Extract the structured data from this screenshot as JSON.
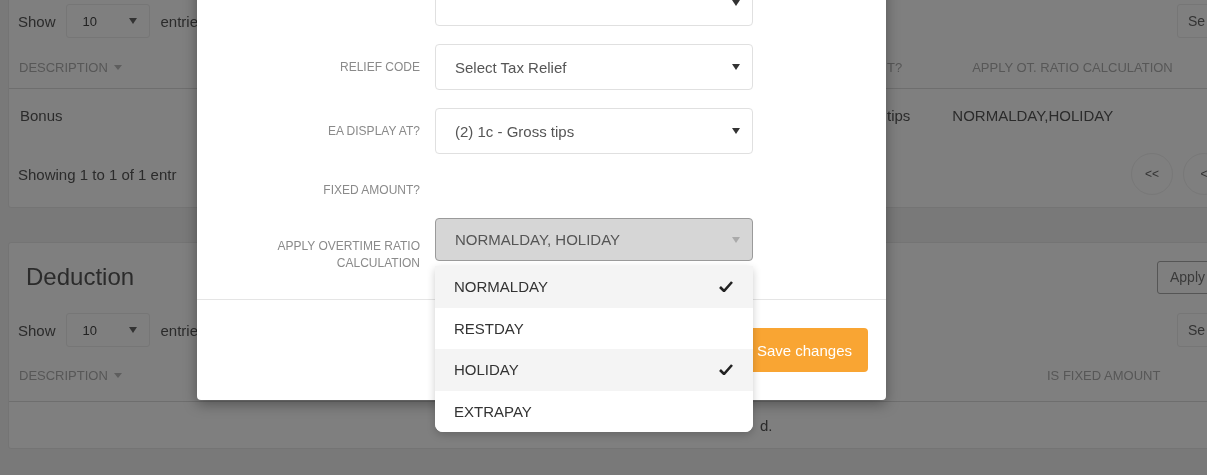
{
  "earnings": {
    "length": {
      "label": "Show",
      "value": "10",
      "suffix": "entrie"
    },
    "search": {
      "placeholder": "Se"
    },
    "columns": [
      {
        "label": "DESCRIPTION",
        "sortable": true
      },
      {
        "label": "T?",
        "sortable": false
      },
      {
        "label": "APPLY OT. RATIO CALCULATION",
        "sortable": false
      }
    ],
    "rows": [
      {
        "cells": [
          "Bonus",
          "tips",
          "NORMALDAY,HOLIDAY"
        ]
      }
    ],
    "info": "Showing 1 to 1 of 1 entr",
    "pagination": [
      "<<",
      "<"
    ]
  },
  "deduction": {
    "title": "Deduction",
    "apply_button": "Apply",
    "length": {
      "label": "Show",
      "value": "10",
      "suffix": "entrie"
    },
    "search": {
      "placeholder": "Se"
    },
    "columns": [
      {
        "label": "DESCRIPTION",
        "sortable": true
      },
      {
        "label": "IS FIXED AMOUNT",
        "sortable": false
      }
    ],
    "empty_message": "d."
  },
  "modal": {
    "fields": [
      {
        "kind": "select"
      },
      {
        "kind": "select",
        "label": "RELIEF CODE",
        "value": "Select Tax Relief"
      },
      {
        "kind": "select",
        "label": "EA DISPLAY AT?",
        "value": "(2) 1c - Gross tips"
      },
      {
        "kind": "empty",
        "label": "FIXED AMOUNT?"
      },
      {
        "kind": "multiselect",
        "label": "APPLY OVERTIME RATIO CALCULATION",
        "value": "NORMALDAY, HOLIDAY",
        "expanded": true,
        "options": [
          {
            "label": "NORMALDAY",
            "selected": true
          },
          {
            "label": "RESTDAY",
            "selected": false
          },
          {
            "label": "HOLIDAY",
            "selected": true
          },
          {
            "label": "EXTRAPAY",
            "selected": false
          }
        ]
      }
    ],
    "save_button": "Save changes"
  }
}
